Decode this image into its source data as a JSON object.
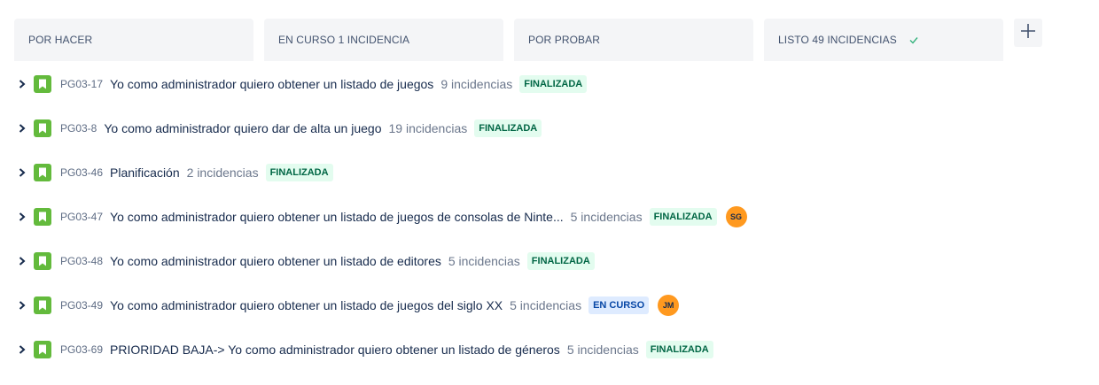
{
  "columns": [
    {
      "label": "POR HACER"
    },
    {
      "label": "EN CURSO 1 INCIDENCIA"
    },
    {
      "label": "POR PROBAR"
    },
    {
      "label": "LISTO 49 INCIDENCIAS",
      "icon": "check-icon"
    }
  ],
  "add_column_icon": "plus-icon",
  "swimlanes": [
    {
      "key": "PG03-17",
      "summary": "Yo como administrador quiero obtener un listado de juegos",
      "count": "9 incidencias",
      "status": "FINALIZADA",
      "status_type": "done",
      "avatar": ""
    },
    {
      "key": "PG03-8",
      "summary": "Yo como administrador quiero dar de alta un juego",
      "count": "19 incidencias",
      "status": "FINALIZADA",
      "status_type": "done",
      "avatar": ""
    },
    {
      "key": "PG03-46",
      "summary": "Planificación",
      "count": "2 incidencias",
      "status": "FINALIZADA",
      "status_type": "done",
      "avatar": ""
    },
    {
      "key": "PG03-47",
      "summary": "Yo como administrador quiero obtener un listado de juegos de consolas de Ninte...",
      "count": "5 incidencias",
      "status": "FINALIZADA",
      "status_type": "done",
      "avatar": "SG"
    },
    {
      "key": "PG03-48",
      "summary": "Yo como administrador quiero obtener un listado de editores",
      "count": "5 incidencias",
      "status": "FINALIZADA",
      "status_type": "done",
      "avatar": ""
    },
    {
      "key": "PG03-49",
      "summary": "Yo como administrador quiero obtener un listado de juegos del siglo XX",
      "count": "5 incidencias",
      "status": "EN CURSO",
      "status_type": "progress",
      "avatar": "JM"
    },
    {
      "key": "PG03-69",
      "summary": "PRIORIDAD BAJA-> Yo como administrador quiero obtener un listado de géneros",
      "count": "5 incidencias",
      "status": "FINALIZADA",
      "status_type": "done",
      "avatar": ""
    }
  ],
  "colors": {
    "story_icon": "#63ba3c",
    "done_bg": "#e3fcef",
    "done_text": "#006644",
    "progress_bg": "#deebff",
    "progress_text": "#0747a6",
    "avatar_bg": "#ff991f"
  }
}
